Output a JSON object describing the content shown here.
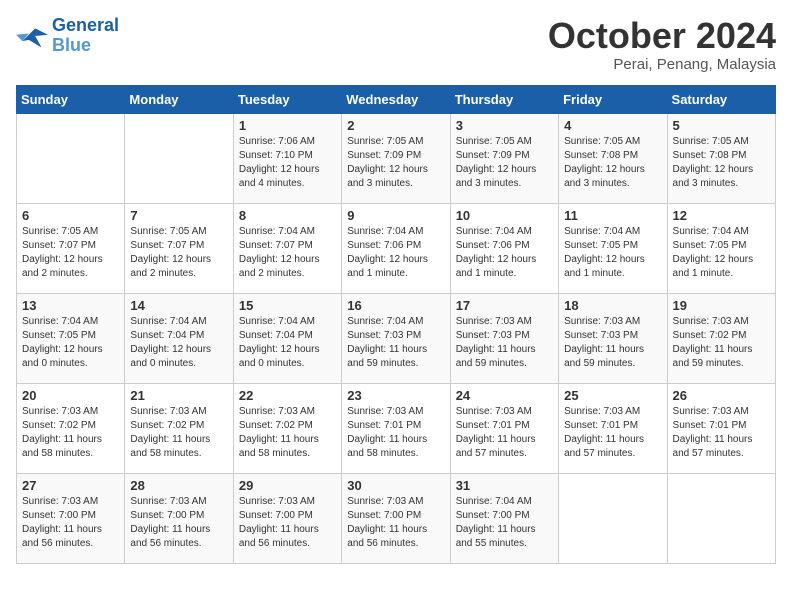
{
  "logo": {
    "line1": "General",
    "line2": "Blue"
  },
  "title": "October 2024",
  "location": "Perai, Penang, Malaysia",
  "headers": [
    "Sunday",
    "Monday",
    "Tuesday",
    "Wednesday",
    "Thursday",
    "Friday",
    "Saturday"
  ],
  "weeks": [
    [
      {
        "day": "",
        "info": ""
      },
      {
        "day": "",
        "info": ""
      },
      {
        "day": "1",
        "info": "Sunrise: 7:06 AM\nSunset: 7:10 PM\nDaylight: 12 hours and 4 minutes."
      },
      {
        "day": "2",
        "info": "Sunrise: 7:05 AM\nSunset: 7:09 PM\nDaylight: 12 hours and 3 minutes."
      },
      {
        "day": "3",
        "info": "Sunrise: 7:05 AM\nSunset: 7:09 PM\nDaylight: 12 hours and 3 minutes."
      },
      {
        "day": "4",
        "info": "Sunrise: 7:05 AM\nSunset: 7:08 PM\nDaylight: 12 hours and 3 minutes."
      },
      {
        "day": "5",
        "info": "Sunrise: 7:05 AM\nSunset: 7:08 PM\nDaylight: 12 hours and 3 minutes."
      }
    ],
    [
      {
        "day": "6",
        "info": "Sunrise: 7:05 AM\nSunset: 7:07 PM\nDaylight: 12 hours and 2 minutes."
      },
      {
        "day": "7",
        "info": "Sunrise: 7:05 AM\nSunset: 7:07 PM\nDaylight: 12 hours and 2 minutes."
      },
      {
        "day": "8",
        "info": "Sunrise: 7:04 AM\nSunset: 7:07 PM\nDaylight: 12 hours and 2 minutes."
      },
      {
        "day": "9",
        "info": "Sunrise: 7:04 AM\nSunset: 7:06 PM\nDaylight: 12 hours and 1 minute."
      },
      {
        "day": "10",
        "info": "Sunrise: 7:04 AM\nSunset: 7:06 PM\nDaylight: 12 hours and 1 minute."
      },
      {
        "day": "11",
        "info": "Sunrise: 7:04 AM\nSunset: 7:05 PM\nDaylight: 12 hours and 1 minute."
      },
      {
        "day": "12",
        "info": "Sunrise: 7:04 AM\nSunset: 7:05 PM\nDaylight: 12 hours and 1 minute."
      }
    ],
    [
      {
        "day": "13",
        "info": "Sunrise: 7:04 AM\nSunset: 7:05 PM\nDaylight: 12 hours and 0 minutes."
      },
      {
        "day": "14",
        "info": "Sunrise: 7:04 AM\nSunset: 7:04 PM\nDaylight: 12 hours and 0 minutes."
      },
      {
        "day": "15",
        "info": "Sunrise: 7:04 AM\nSunset: 7:04 PM\nDaylight: 12 hours and 0 minutes."
      },
      {
        "day": "16",
        "info": "Sunrise: 7:04 AM\nSunset: 7:03 PM\nDaylight: 11 hours and 59 minutes."
      },
      {
        "day": "17",
        "info": "Sunrise: 7:03 AM\nSunset: 7:03 PM\nDaylight: 11 hours and 59 minutes."
      },
      {
        "day": "18",
        "info": "Sunrise: 7:03 AM\nSunset: 7:03 PM\nDaylight: 11 hours and 59 minutes."
      },
      {
        "day": "19",
        "info": "Sunrise: 7:03 AM\nSunset: 7:02 PM\nDaylight: 11 hours and 59 minutes."
      }
    ],
    [
      {
        "day": "20",
        "info": "Sunrise: 7:03 AM\nSunset: 7:02 PM\nDaylight: 11 hours and 58 minutes."
      },
      {
        "day": "21",
        "info": "Sunrise: 7:03 AM\nSunset: 7:02 PM\nDaylight: 11 hours and 58 minutes."
      },
      {
        "day": "22",
        "info": "Sunrise: 7:03 AM\nSunset: 7:02 PM\nDaylight: 11 hours and 58 minutes."
      },
      {
        "day": "23",
        "info": "Sunrise: 7:03 AM\nSunset: 7:01 PM\nDaylight: 11 hours and 58 minutes."
      },
      {
        "day": "24",
        "info": "Sunrise: 7:03 AM\nSunset: 7:01 PM\nDaylight: 11 hours and 57 minutes."
      },
      {
        "day": "25",
        "info": "Sunrise: 7:03 AM\nSunset: 7:01 PM\nDaylight: 11 hours and 57 minutes."
      },
      {
        "day": "26",
        "info": "Sunrise: 7:03 AM\nSunset: 7:01 PM\nDaylight: 11 hours and 57 minutes."
      }
    ],
    [
      {
        "day": "27",
        "info": "Sunrise: 7:03 AM\nSunset: 7:00 PM\nDaylight: 11 hours and 56 minutes."
      },
      {
        "day": "28",
        "info": "Sunrise: 7:03 AM\nSunset: 7:00 PM\nDaylight: 11 hours and 56 minutes."
      },
      {
        "day": "29",
        "info": "Sunrise: 7:03 AM\nSunset: 7:00 PM\nDaylight: 11 hours and 56 minutes."
      },
      {
        "day": "30",
        "info": "Sunrise: 7:03 AM\nSunset: 7:00 PM\nDaylight: 11 hours and 56 minutes."
      },
      {
        "day": "31",
        "info": "Sunrise: 7:04 AM\nSunset: 7:00 PM\nDaylight: 11 hours and 55 minutes."
      },
      {
        "day": "",
        "info": ""
      },
      {
        "day": "",
        "info": ""
      }
    ]
  ]
}
